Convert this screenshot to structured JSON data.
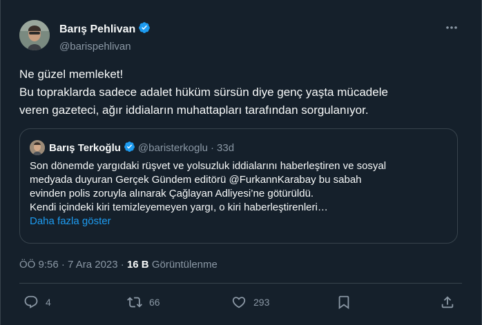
{
  "tweet": {
    "author": {
      "name": "Barış Pehlivan",
      "handle": "@barispehlivan",
      "verified": true
    },
    "menu_icon": "more-horizontal-icon",
    "body_lines": [
      "Ne güzel memleket!",
      "Bu topraklarda sadece adalet hüküm sürsün diye genç yaşta mücadele",
      "veren gazeteci, ağır iddiaların muhattapları tarafından sorgulanıyor."
    ],
    "quote": {
      "name": "Barış Terkoğlu",
      "handle": "@baristerkoglu",
      "separator": "·",
      "age": "33d",
      "lines": [
        "Son dönemde yargıdaki rüşvet ve yolsuzluk iddialarını haberleştiren ve sosyal",
        "medyada duyuran Gerçek Gündem editörü @FurkannKarabay bu sabah",
        "evinden polis zoruyla alınarak Çağlayan Adliyesi’ne götürüldü.",
        "Kendi içindeki kiri temizleyemeyen yargı, o kiri haberleştirenleri…"
      ],
      "show_more": "Daha fazla göster"
    },
    "meta": {
      "time": "ÖÖ 9:56",
      "dot1": "·",
      "date": "7 Ara 2023",
      "dot2": "·",
      "views_count": "16 B",
      "views_label": "Görüntülenme"
    },
    "actions": {
      "replies": "4",
      "retweets": "66",
      "likes": "293"
    },
    "colors": {
      "background": "#15202b",
      "text": "#f7f9f9",
      "muted": "#8b98a5",
      "accent": "#1d9bf0",
      "border": "#38444d"
    }
  }
}
